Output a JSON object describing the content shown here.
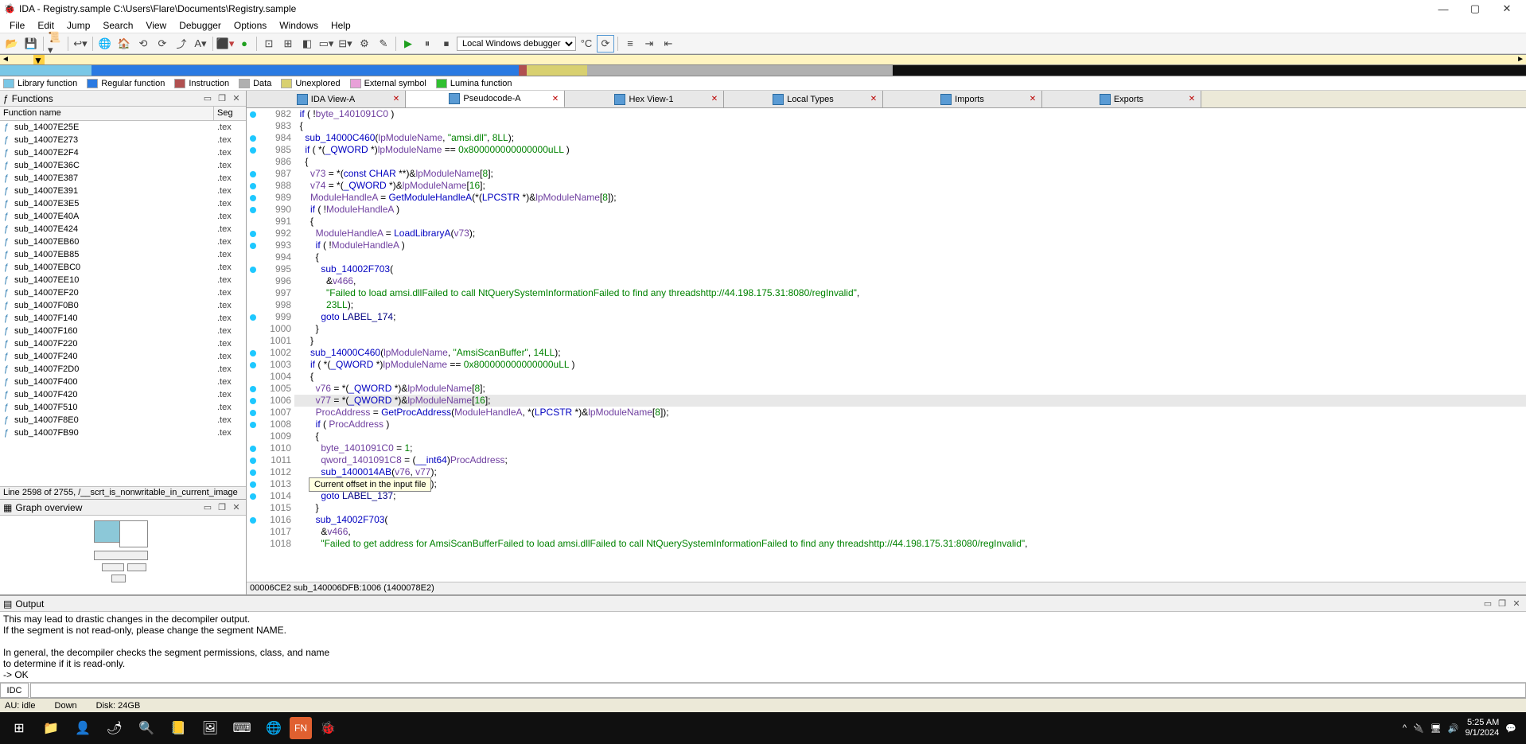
{
  "window": {
    "title": "IDA - Registry.sample C:\\Users\\Flare\\Documents\\Registry.sample"
  },
  "menus": [
    "File",
    "Edit",
    "Jump",
    "Search",
    "View",
    "Debugger",
    "Options",
    "Windows",
    "Help"
  ],
  "debugger_combo": "Local Windows debugger",
  "legend": [
    {
      "label": "Library function",
      "color": "#7ac7e6"
    },
    {
      "label": "Regular function",
      "color": "#2a7ae2"
    },
    {
      "label": "Instruction",
      "color": "#b05050"
    },
    {
      "label": "Data",
      "color": "#b0b0b0"
    },
    {
      "label": "Unexplored",
      "color": "#d8d070"
    },
    {
      "label": "External symbol",
      "color": "#e8a0d8"
    },
    {
      "label": "Lumina function",
      "color": "#30c030"
    }
  ],
  "functions_panel": {
    "title": "Functions",
    "col1": "Function name",
    "col2": "Seg",
    "status": "Line 2598 of 2755, /__scrt_is_nonwritable_in_current_image",
    "items": [
      {
        "name": "sub_14007E25E",
        "seg": ".tex"
      },
      {
        "name": "sub_14007E273",
        "seg": ".tex"
      },
      {
        "name": "sub_14007E2F4",
        "seg": ".tex"
      },
      {
        "name": "sub_14007E36C",
        "seg": ".tex"
      },
      {
        "name": "sub_14007E387",
        "seg": ".tex"
      },
      {
        "name": "sub_14007E391",
        "seg": ".tex"
      },
      {
        "name": "sub_14007E3E5",
        "seg": ".tex"
      },
      {
        "name": "sub_14007E40A",
        "seg": ".tex"
      },
      {
        "name": "sub_14007E424",
        "seg": ".tex"
      },
      {
        "name": "sub_14007EB60",
        "seg": ".tex"
      },
      {
        "name": "sub_14007EB85",
        "seg": ".tex"
      },
      {
        "name": "sub_14007EBC0",
        "seg": ".tex"
      },
      {
        "name": "sub_14007EE10",
        "seg": ".tex"
      },
      {
        "name": "sub_14007EF20",
        "seg": ".tex"
      },
      {
        "name": "sub_14007F0B0",
        "seg": ".tex"
      },
      {
        "name": "sub_14007F140",
        "seg": ".tex"
      },
      {
        "name": "sub_14007F160",
        "seg": ".tex"
      },
      {
        "name": "sub_14007F220",
        "seg": ".tex"
      },
      {
        "name": "sub_14007F240",
        "seg": ".tex"
      },
      {
        "name": "sub_14007F2D0",
        "seg": ".tex"
      },
      {
        "name": "sub_14007F400",
        "seg": ".tex"
      },
      {
        "name": "sub_14007F420",
        "seg": ".tex"
      },
      {
        "name": "sub_14007F510",
        "seg": ".tex"
      },
      {
        "name": "sub_14007F8E0",
        "seg": ".tex"
      },
      {
        "name": "sub_14007FB90",
        "seg": ".tex"
      }
    ]
  },
  "graph_panel": {
    "title": "Graph overview"
  },
  "tabs": [
    {
      "label": "IDA View-A",
      "active": false
    },
    {
      "label": "Pseudocode-A",
      "active": true
    },
    {
      "label": "Hex View-1",
      "active": false
    },
    {
      "label": "Local Types",
      "active": false
    },
    {
      "label": "Imports",
      "active": false
    },
    {
      "label": "Exports",
      "active": false
    }
  ],
  "code": {
    "status": "00006CE2 sub_140006DFB:1006 (1400078E2)",
    "lines": [
      {
        "n": 982,
        "bp": true,
        "html": "  <span class='kw'>if</span> ( !<span class='var'>byte_1401091C0</span> )"
      },
      {
        "n": 983,
        "bp": false,
        "html": "  {"
      },
      {
        "n": 984,
        "bp": true,
        "html": "    <span class='fn'>sub_14000C460</span>(<span class='var'>lpModuleName</span>, <span class='str'>\"amsi.dll\"</span>, <span class='num'>8LL</span>);"
      },
      {
        "n": 985,
        "bp": true,
        "html": "    <span class='kw'>if</span> ( *(<span class='type'>_QWORD</span> *)<span class='var'>lpModuleName</span> == <span class='num'>0x800000000000000uLL</span> )"
      },
      {
        "n": 986,
        "bp": false,
        "html": "    {"
      },
      {
        "n": 987,
        "bp": true,
        "html": "      <span class='var'>v73</span> = *(<span class='kw'>const</span> <span class='type'>CHAR</span> **)&amp;<span class='var'>lpModuleName</span>[<span class='num'>8</span>];"
      },
      {
        "n": 988,
        "bp": true,
        "html": "      <span class='var'>v74</span> = *(<span class='type'>_QWORD</span> *)&amp;<span class='var'>lpModuleName</span>[<span class='num'>16</span>];"
      },
      {
        "n": 989,
        "bp": true,
        "html": "      <span class='var'>ModuleHandleA</span> = <span class='fn'>GetModuleHandleA</span>(*(<span class='type'>LPCSTR</span> *)&amp;<span class='var'>lpModuleName</span>[<span class='num'>8</span>]);"
      },
      {
        "n": 990,
        "bp": true,
        "html": "      <span class='kw'>if</span> ( !<span class='var'>ModuleHandleA</span> )"
      },
      {
        "n": 991,
        "bp": false,
        "html": "      {"
      },
      {
        "n": 992,
        "bp": true,
        "html": "        <span class='var'>ModuleHandleA</span> = <span class='fn'>LoadLibraryA</span>(<span class='var'>v73</span>);"
      },
      {
        "n": 993,
        "bp": true,
        "html": "        <span class='kw'>if</span> ( !<span class='var'>ModuleHandleA</span> )"
      },
      {
        "n": 994,
        "bp": false,
        "html": "        {"
      },
      {
        "n": 995,
        "bp": true,
        "html": "          <span class='fn'>sub_14002F703</span>("
      },
      {
        "n": 996,
        "bp": false,
        "html": "            &amp;<span class='var'>v466</span>,"
      },
      {
        "n": 997,
        "bp": false,
        "html": "            <span class='str'>\"Failed to load amsi.dllFailed to call NtQuerySystemInformationFailed to find any threadshttp://44.198.175.31:8080/regInvalid\"</span>,"
      },
      {
        "n": 998,
        "bp": false,
        "html": "            <span class='num'>23LL</span>);"
      },
      {
        "n": 999,
        "bp": true,
        "html": "          <span class='kw'>goto</span> <span class='addr'>LABEL_174</span>;"
      },
      {
        "n": 1000,
        "bp": false,
        "html": "        }"
      },
      {
        "n": 1001,
        "bp": false,
        "html": "      }"
      },
      {
        "n": 1002,
        "bp": true,
        "html": "      <span class='fn'>sub_14000C460</span>(<span class='var'>lpModuleName</span>, <span class='str'>\"AmsiScanBuffer\"</span>, <span class='num'>14LL</span>);"
      },
      {
        "n": 1003,
        "bp": true,
        "html": "      <span class='kw'>if</span> ( *(<span class='type'>_QWORD</span> *)<span class='var'>lpModuleName</span> == <span class='num'>0x800000000000000uLL</span> )"
      },
      {
        "n": 1004,
        "bp": false,
        "html": "      {"
      },
      {
        "n": 1005,
        "bp": true,
        "html": "        <span class='var'>v76</span> = *(<span class='type'>_QWORD</span> *)&amp;<span class='var'>lpModuleName</span>[<span class='num'>8</span>];"
      },
      {
        "n": 1006,
        "bp": true,
        "hl": true,
        "html": "        <span class='var'>v77</span> = *(<span class='type'>_QWORD</span> *)&amp;<span class='var'>lpModuleName</span>[<span class='num'>16</span>];"
      },
      {
        "n": 1007,
        "bp": true,
        "html": "        <span class='var'>ProcAddress</span> = <span class='fn'>GetProcAddress</span>(<span class='var'>ModuleHandleA</span>, *(<span class='type'>LPCSTR</span> *)&amp;<span class='var'>lpModuleName</span>[<span class='num'>8</span>]);"
      },
      {
        "n": 1008,
        "bp": true,
        "html": "        <span class='kw'>if</span> ( <span class='var'>ProcAddress</span> )"
      },
      {
        "n": 1009,
        "bp": false,
        "html": "        {"
      },
      {
        "n": 1010,
        "bp": true,
        "html": "          <span class='var'>byte_1401091C0</span> = <span class='num'>1</span>;"
      },
      {
        "n": 1011,
        "bp": true,
        "html": "          <span class='var'>qword_1401091C8</span> = (<span class='type'>__int64</span>)<span class='var'>ProcAddress</span>;"
      },
      {
        "n": 1012,
        "bp": true,
        "html": "          <span class='fn'>sub_1400014AB</span>(<span class='var'>v76</span>, <span class='var'>v77</span>);"
      },
      {
        "n": 1013,
        "bp": true,
        "html": "          <span class='fn'>sub_1400014AB</span>(<span class='var'>v73</span>, <span class='var'>v74</span>);"
      },
      {
        "n": 1014,
        "bp": true,
        "html": "          <span class='kw'>goto</span> <span class='addr'>LABEL_137</span>;"
      },
      {
        "n": 1015,
        "bp": false,
        "html": "        }"
      },
      {
        "n": 1016,
        "bp": true,
        "html": "        <span class='fn'>sub_14002F703</span>("
      },
      {
        "n": 1017,
        "bp": false,
        "html": "          &amp;<span class='var'>v466</span>,"
      },
      {
        "n": 1018,
        "bp": false,
        "html": "          <span class='str'>\"Failed to get address for AmsiScanBufferFailed to load amsi.dllFailed to call NtQuerySystemInformationFailed to find any threadshttp://44.198.175.31:8080/regInvalid\"</span>,"
      }
    ]
  },
  "tooltip": "Current offset in the input file",
  "output": {
    "title": "Output",
    "lines": [
      "This may lead to drastic changes in the decompiler output.",
      "If the segment is not read-only, please change the segment NAME.",
      "",
      "In general, the decompiler checks the segment permissions, class, and name",
      "to determine if it is read-only.",
      " -> OK"
    ],
    "idc_label": "IDC"
  },
  "status": {
    "au": "AU:  idle",
    "down": "Down",
    "disk": "Disk: 24GB"
  },
  "tray": {
    "time": "5:25 AM",
    "date": "9/1/2024"
  }
}
